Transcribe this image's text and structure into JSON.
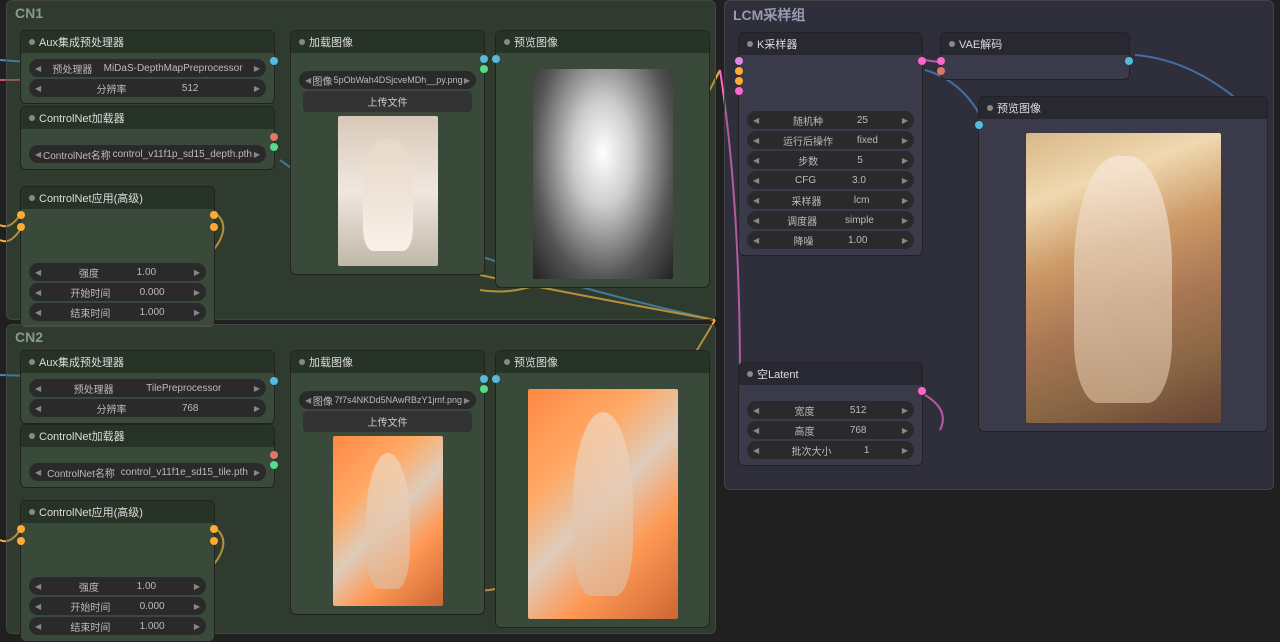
{
  "groups": {
    "cn1": {
      "title": "CN1"
    },
    "cn2": {
      "title": "CN2"
    },
    "lcm": {
      "title": "LCM采样组"
    }
  },
  "cn1": {
    "aux": {
      "title": "Aux集成预处理器",
      "preprocessor_label": "预处理器",
      "preprocessor_value": "MiDaS-DepthMapPreprocessor",
      "resolution_label": "分辨率",
      "resolution_value": "512"
    },
    "loader": {
      "title": "ControlNet加载器",
      "name_label": "ControlNet名称",
      "name_value": "control_v11f1p_sd15_depth.pth"
    },
    "apply": {
      "title": "ControlNet应用(高级)",
      "strength_label": "强度",
      "strength_value": "1.00",
      "start_label": "开始时间",
      "start_value": "0.000",
      "end_label": "结束时间",
      "end_value": "1.000"
    },
    "loadimg": {
      "title": "加载图像",
      "image_label": "图像",
      "image_value": "5pObWah4DSjcveMDh__py.png",
      "upload": "上传文件"
    },
    "preview": {
      "title": "预览图像"
    }
  },
  "cn2": {
    "aux": {
      "title": "Aux集成预处理器",
      "preprocessor_label": "预处理器",
      "preprocessor_value": "TilePreprocessor",
      "resolution_label": "分辨率",
      "resolution_value": "768"
    },
    "loader": {
      "title": "ControlNet加载器",
      "name_label": "ControlNet名称",
      "name_value": "control_v11f1e_sd15_tile.pth"
    },
    "apply": {
      "title": "ControlNet应用(高级)",
      "strength_label": "强度",
      "strength_value": "1.00",
      "start_label": "开始时间",
      "start_value": "0.000",
      "end_label": "结束时间",
      "end_value": "1.000"
    },
    "loadimg": {
      "title": "加载图像",
      "image_label": "图像",
      "image_value": "7f7s4NKDd5NAwRBzY1jmf.png",
      "upload": "上传文件"
    },
    "preview": {
      "title": "预览图像"
    }
  },
  "lcm": {
    "ksampler": {
      "title": "K采样器",
      "seed_label": "随机种",
      "seed_value": "25",
      "control_label": "运行后操作",
      "control_value": "fixed",
      "steps_label": "步数",
      "steps_value": "5",
      "cfg_label": "CFG",
      "cfg_value": "3.0",
      "sampler_label": "采样器",
      "sampler_value": "lcm",
      "scheduler_label": "调度器",
      "scheduler_value": "simple",
      "denoise_label": "降噪",
      "denoise_value": "1.00"
    },
    "vae": {
      "title": "VAE解码"
    },
    "latent": {
      "title": "空Latent",
      "width_label": "宽度",
      "width_value": "512",
      "height_label": "高度",
      "height_value": "768",
      "batch_label": "批次大小",
      "batch_value": "1"
    },
    "preview": {
      "title": "预览图像"
    }
  }
}
